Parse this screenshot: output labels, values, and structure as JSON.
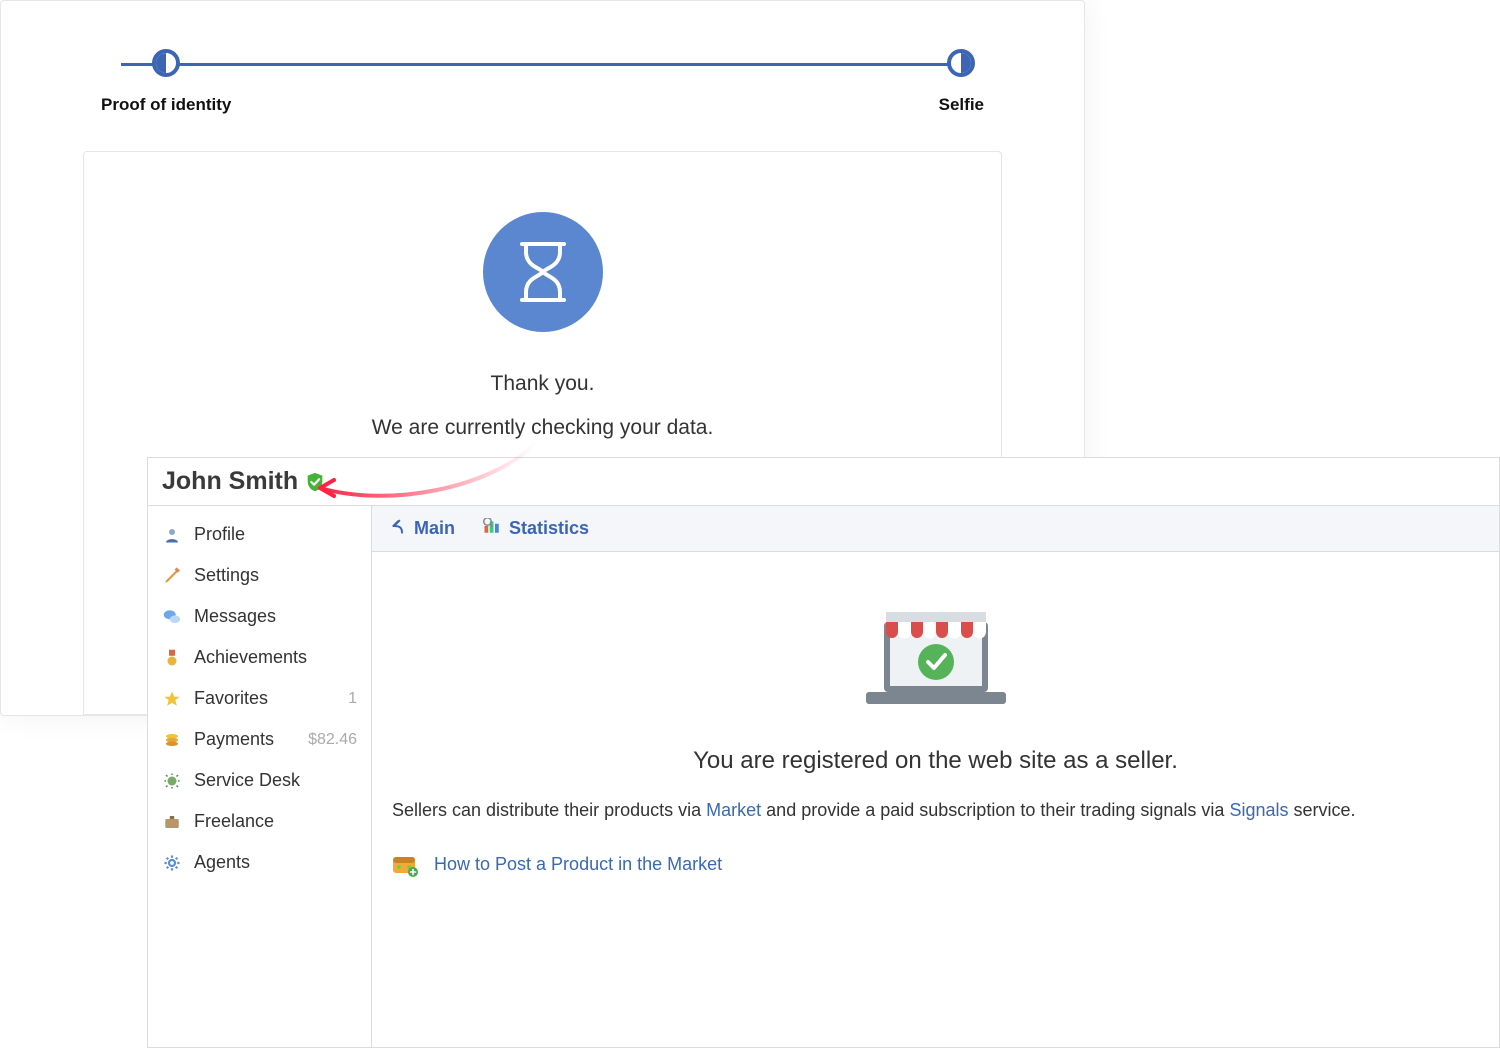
{
  "verification": {
    "step1_label": "Proof of identity",
    "step2_label": "Selfie",
    "thanks": "Thank you.",
    "checking": "We are currently checking your data."
  },
  "profile": {
    "name": "John Smith"
  },
  "sidebar": {
    "items": [
      {
        "icon": "person-icon",
        "label": "Profile",
        "meta": ""
      },
      {
        "icon": "pencil-icon",
        "label": "Settings",
        "meta": ""
      },
      {
        "icon": "chat-icon",
        "label": "Messages",
        "meta": ""
      },
      {
        "icon": "medal-icon",
        "label": "Achievements",
        "meta": ""
      },
      {
        "icon": "star-icon",
        "label": "Favorites",
        "meta": "1"
      },
      {
        "icon": "coins-icon",
        "label": "Payments",
        "meta": "$82.46"
      },
      {
        "icon": "bug-icon",
        "label": "Service Desk",
        "meta": ""
      },
      {
        "icon": "briefcase-icon",
        "label": "Freelance",
        "meta": ""
      },
      {
        "icon": "gear-icon",
        "label": "Agents",
        "meta": ""
      }
    ]
  },
  "tabs": {
    "main": "Main",
    "statistics": "Statistics"
  },
  "seller": {
    "headline": "You are registered on the web site as a seller.",
    "intro_pre": "Sellers can distribute their products via ",
    "market_link": "Market",
    "intro_mid": " and provide a paid subscription to their trading signals via ",
    "signals_link": "Signals",
    "intro_post": " service.",
    "howto": "How to Post a Product in the Market"
  }
}
